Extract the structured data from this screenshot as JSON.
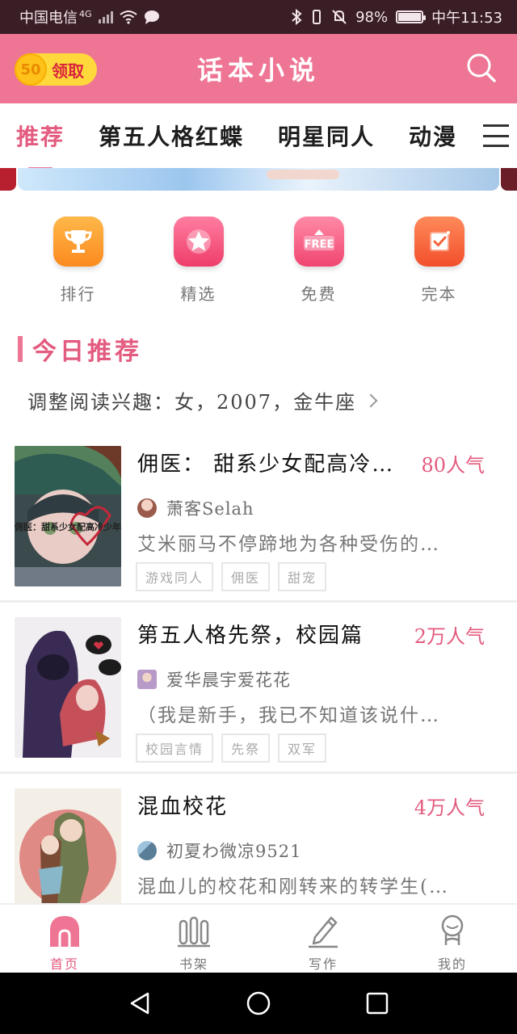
{
  "status_bar": {
    "carrier": "中国电信",
    "network": "4G",
    "battery": "98%",
    "battery_level": 0.98,
    "time": "中午11:53"
  },
  "app_bar": {
    "coin_value": "50",
    "coin_label": "领取",
    "title": "话本小说",
    "search_icon": "search-icon"
  },
  "tabs": [
    {
      "label": "推荐",
      "active": true
    },
    {
      "label": "第五人格红蝶",
      "active": false
    },
    {
      "label": "明星同人",
      "active": false
    },
    {
      "label": "动漫",
      "active": false
    }
  ],
  "quick_nav": [
    {
      "label": "排行",
      "icon": "trophy-icon",
      "color": "#fd9a2c"
    },
    {
      "label": "精选",
      "icon": "star-icon",
      "color": "#f0527a"
    },
    {
      "label": "免费",
      "icon": "free-icon",
      "icon_text": "FREE",
      "color": "#f4587a"
    },
    {
      "label": "完本",
      "icon": "check-icon",
      "color": "#fb6a35"
    }
  ],
  "section": {
    "title": "今日推荐",
    "interest_text": "调整阅读兴趣：女，2007，金牛座"
  },
  "books": [
    {
      "title": "佣医： 甜系少女配高冷…",
      "popularity": "80人气",
      "author": "萧客Selah",
      "description": "艾米丽马不停蹄地为各种受伤的…",
      "tags": [
        "游戏同人",
        "佣医",
        "甜宠"
      ],
      "cover_text": "佣医：甜系少女配高冷少年"
    },
    {
      "title": "第五人格先祭，校园篇",
      "popularity": "2万人气",
      "author": "爱华晨宇爱花花",
      "description": "（我是新手，我已不知道该说什…",
      "tags": [
        "校园言情",
        "先祭",
        "双军"
      ]
    },
    {
      "title": "混血校花",
      "popularity": "4万人气",
      "author": "初夏わ微凉9521",
      "description": "混血儿的校花和刚转来的转学生(…",
      "tags": []
    }
  ],
  "bottom_nav": [
    {
      "label": "首页",
      "icon": "home-icon",
      "active": true
    },
    {
      "label": "书架",
      "icon": "bookshelf-icon",
      "active": false
    },
    {
      "label": "写作",
      "icon": "pencil-icon",
      "active": false
    },
    {
      "label": "我的",
      "icon": "profile-icon",
      "active": false
    }
  ],
  "colors": {
    "brand_pink": "#ee7594",
    "accent_text": "#e35b7e",
    "status_bar": "#3a1e26"
  }
}
